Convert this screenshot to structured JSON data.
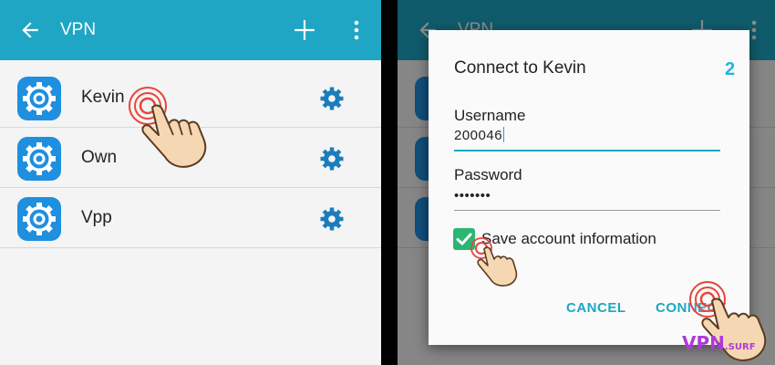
{
  "left_screen": {
    "appbar": {
      "title": "VPN",
      "back_icon": "arrow-back-icon",
      "add_icon": "plus-icon",
      "overflow_icon": "more-vert-icon",
      "color": "#1ea6c4"
    },
    "profiles": [
      {
        "label": "Kevin"
      },
      {
        "label": "Own"
      },
      {
        "label": "Vpp"
      }
    ],
    "profile_icon": "settings-app-icon",
    "profile_settings_icon": "gear-icon"
  },
  "right_screen": {
    "appbar_title": "VPN",
    "step_number": "2",
    "dialog": {
      "title": "Connect to Kevin",
      "username_label": "Username",
      "username_value": "200046",
      "password_label": "Password",
      "password_value": "•••••••",
      "save_checked": true,
      "save_label": "Save account information",
      "cancel_label": "CANCEL",
      "connect_label": "CONNECT"
    }
  },
  "watermark": {
    "main": "VPN",
    "suffix": ".SURF"
  },
  "colors": {
    "accent": "#1ea6c4",
    "checkbox": "#2bb673",
    "watermark": "#b03ad6",
    "tap": "#e8453c"
  }
}
